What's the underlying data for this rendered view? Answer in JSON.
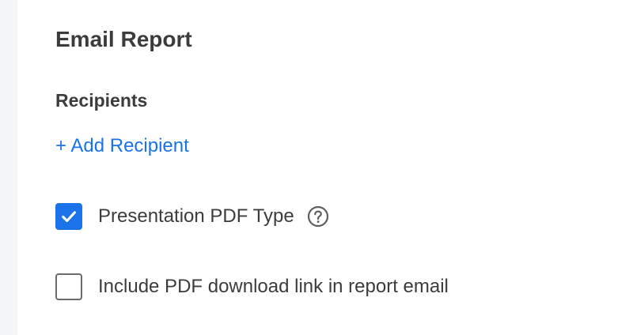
{
  "section": {
    "title": "Email Report"
  },
  "recipients": {
    "heading": "Recipients",
    "add_label": "+ Add Recipient"
  },
  "options": [
    {
      "label": "Presentation PDF Type",
      "checked": true,
      "help_icon": "question-circle-icon"
    },
    {
      "label": "Include PDF download link in report email",
      "checked": false
    }
  ],
  "colors": {
    "accent": "#1a73e8",
    "text": "#3c3c3c",
    "checkbox_border": "#6b6b6b",
    "gutter": "#f4f5f7"
  }
}
